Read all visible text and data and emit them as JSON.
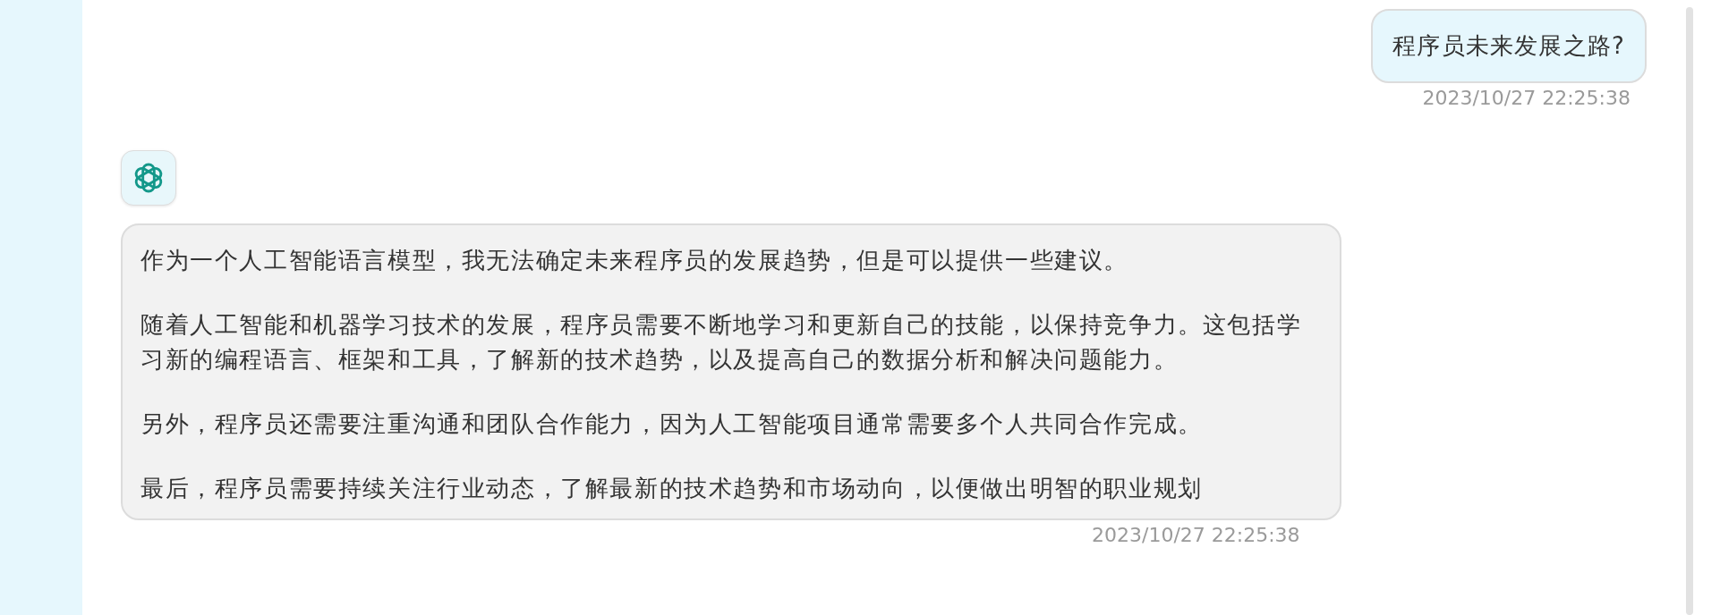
{
  "messages": [
    {
      "kind": "user",
      "paragraphs": [
        "程序员未来发展之路?"
      ],
      "time": "2023/10/27 22:25:38"
    },
    {
      "kind": "bot",
      "paragraphs": [
        "作为一个人工智能语言模型，我无法确定未来程序员的发展趋势，但是可以提供一些建议。",
        "随着人工智能和机器学习技术的发展，程序员需要不断地学习和更新自己的技能，以保持竞争力。这包括学习新的编程语言、框架和工具，了解新的技术趋势，以及提高自己的数据分析和解决问题能力。",
        "另外，程序员还需要注重沟通和团队合作能力，因为人工智能项目通常需要多个人共同合作完成。",
        "最后，程序员需要持续关注行业动态，了解最新的技术趋势和市场动向，以便做出明智的职业规划"
      ],
      "time": "2023/10/27 22:25:38"
    }
  ]
}
